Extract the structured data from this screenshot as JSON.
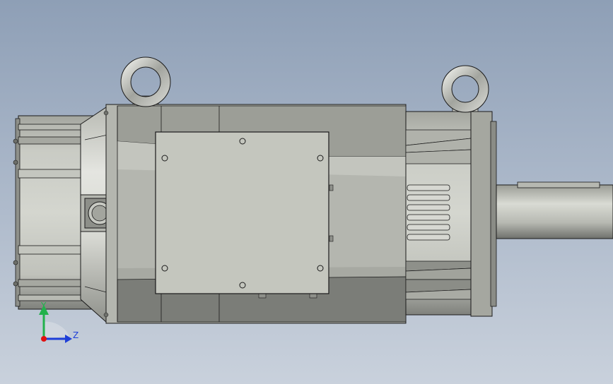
{
  "triad": {
    "y_label": "Y",
    "z_label": "Z",
    "y_color": "#22b14c",
    "z_color": "#1f3fd8",
    "origin_color": "#e01010"
  },
  "colors": {
    "background_top": "#8e9fb6",
    "background_bottom": "#c9d1dc",
    "body_light": "#c6c8c1",
    "body_mid": "#a9aba4",
    "body_dark": "#7d7f7a",
    "panel": "#c2c4bc",
    "outline": "#1a1a1a"
  },
  "icons": [
    "eye-bolt-icon",
    "connector-icon",
    "coordinate-triad-icon"
  ]
}
